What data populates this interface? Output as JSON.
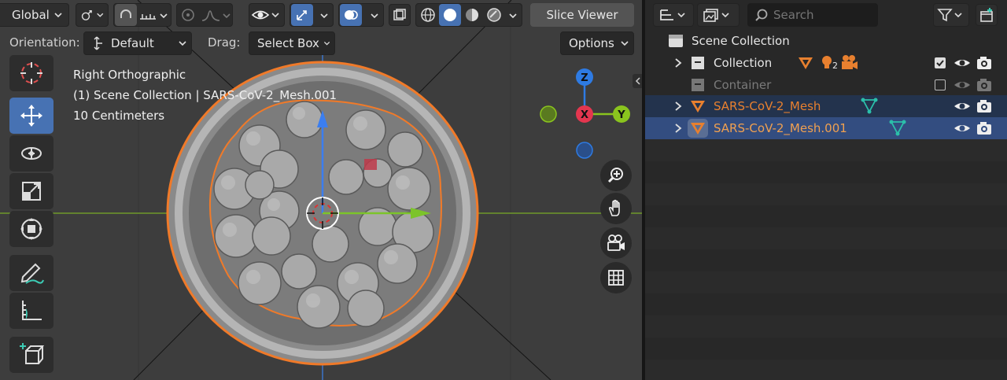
{
  "viewport": {
    "header": {
      "transform_orientation": "Global",
      "slice_viewer_label": "Slice Viewer"
    },
    "tool_header": {
      "orientation_label": "Orientation:",
      "orientation_value": "Default",
      "drag_label": "Drag:",
      "drag_value": "Select Box",
      "options_label": "Options"
    },
    "overlay": {
      "view_name": "Right Orthographic",
      "active_object": "(1) Scene Collection | SARS-CoV-2_Mesh.001",
      "grid_scale": "10 Centimeters"
    },
    "gizmo": {
      "z_label": "Z",
      "x_label": "X",
      "y_label": "Y"
    },
    "toolbar_tools": [
      "cursor-tool",
      "move-tool",
      "rotate-tool",
      "scale-tool",
      "transform-tool",
      "annotate-tool",
      "measure-tool",
      "add-cube-tool"
    ],
    "active_tool": "move-tool",
    "colors": {
      "viewport_bg": "#3d3d3d",
      "active_blue": "#4772b3",
      "selection_orange": "#f07a29",
      "axis_x": "#e4364f",
      "axis_y": "#8ac41e",
      "axis_z": "#2e7be3"
    }
  },
  "outliner": {
    "search_placeholder": "Search",
    "rows": [
      {
        "label": "Scene Collection"
      },
      {
        "label": "Collection",
        "users_badge": "2"
      },
      {
        "label": "Container"
      },
      {
        "label": "SARS-CoV-2_Mesh"
      },
      {
        "label": "SARS-CoV-2_Mesh.001"
      }
    ],
    "colors": {
      "selected_row": "#334d80",
      "highlight_row": "#23334d",
      "object_orange": "#e8802f",
      "mesh_teal": "#2bbfaa"
    }
  }
}
